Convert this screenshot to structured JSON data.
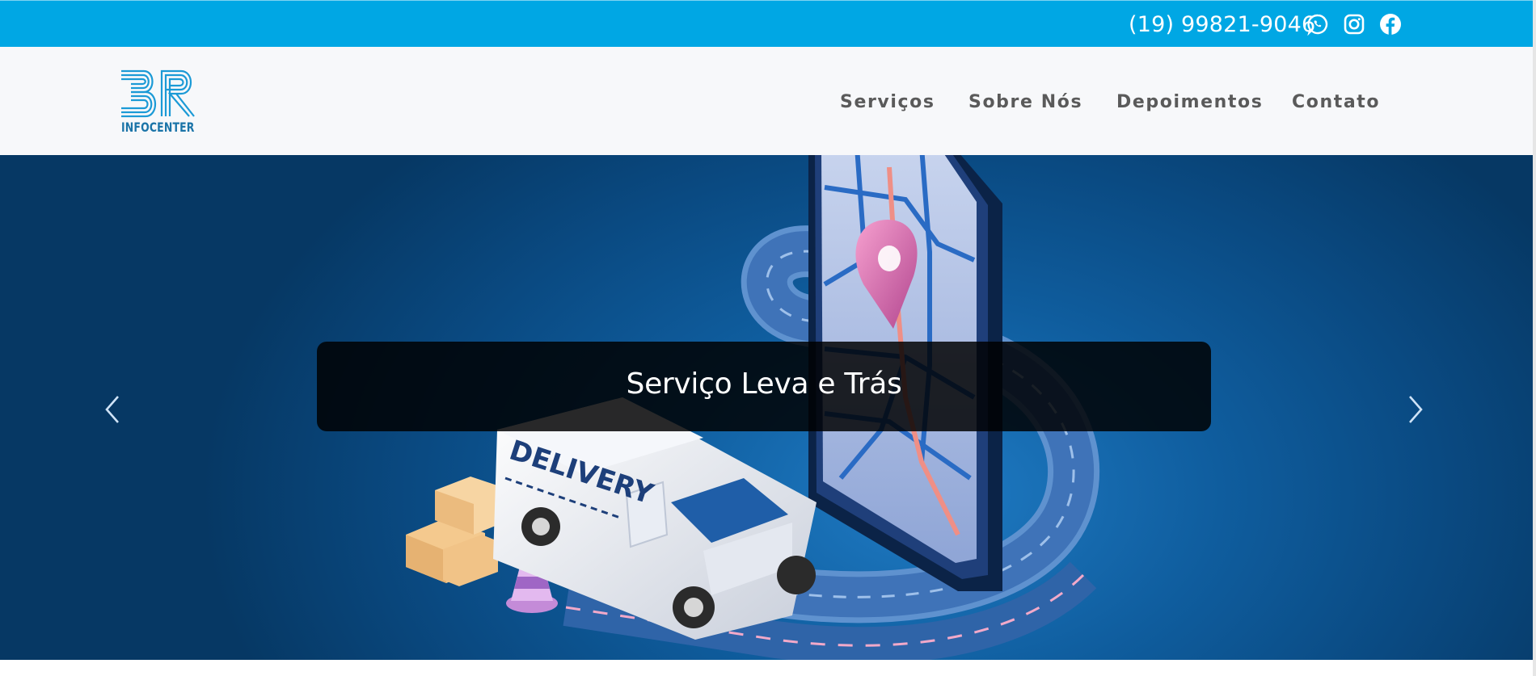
{
  "topbar": {
    "phone": "(19) 99821-9046",
    "icons": [
      "whatsapp-icon",
      "instagram-icon",
      "facebook-icon"
    ],
    "background_color": "#00a7e4"
  },
  "header": {
    "logo_text": "INFOCENTER",
    "logo_monogram": "BR",
    "nav": [
      {
        "label": "Serviços"
      },
      {
        "label": "Sobre Nós"
      },
      {
        "label": "Depoimentos"
      },
      {
        "label": "Contato"
      }
    ]
  },
  "hero": {
    "caption": "Serviço Leva e Trás",
    "van_text": "DELIVERY",
    "prev_icon": "chevron-left-icon",
    "next_icon": "chevron-right-icon"
  },
  "colors": {
    "accent": "#00a7e4",
    "nav_text": "#5a5a5a",
    "logo_blue": "#1b74a8",
    "hero_dark": "#063864"
  }
}
